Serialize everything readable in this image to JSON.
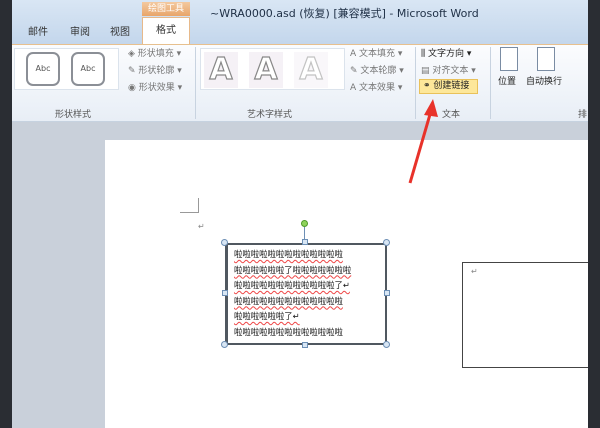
{
  "window": {
    "title": "~WRA0000.asd (恢复) [兼容模式] - Microsoft Word",
    "context_tab": "绘图工具"
  },
  "tabs": [
    {
      "label": "邮件"
    },
    {
      "label": "审阅"
    },
    {
      "label": "视图"
    },
    {
      "label": "格式",
      "active": true
    }
  ],
  "ribbon": {
    "shape_styles": {
      "label": "形状样式",
      "thumbs": [
        "Abc",
        "Abc"
      ],
      "commands": [
        "形状填充",
        "形状轮廓",
        "形状效果"
      ]
    },
    "wordart_styles": {
      "label": "艺术字样式",
      "thumbs": [
        "A",
        "A",
        "A"
      ],
      "commands": [
        "文本填充",
        "文本轮廓",
        "文本效果"
      ]
    },
    "text": {
      "label": "文本",
      "commands": [
        "文字方向",
        "对齐文本",
        "创建链接"
      ]
    },
    "arrange": {
      "label": "排",
      "commands": [
        "位置",
        "自动换行"
      ]
    }
  },
  "document": {
    "textbox_lines": [
      "啦啦啦啦啦啦啦啦啦啦啦啦啦",
      "啦啦啦啦啦啦了啦啦啦啦啦啦啦",
      "啦啦啦啦啦啦啦啦啦啦啦啦了↵",
      "啦啦啦啦啦啦啦啦啦啦啦啦啦",
      "啦啦啦啦啦啦了↵",
      "啦啦啦啦啦啦啦啦啦啦啦啦啦"
    ],
    "second_box_text": "↵",
    "paragraph_mark": "↵"
  },
  "colors": {
    "highlight": "#fde79a",
    "arrow": "#e8322a"
  }
}
